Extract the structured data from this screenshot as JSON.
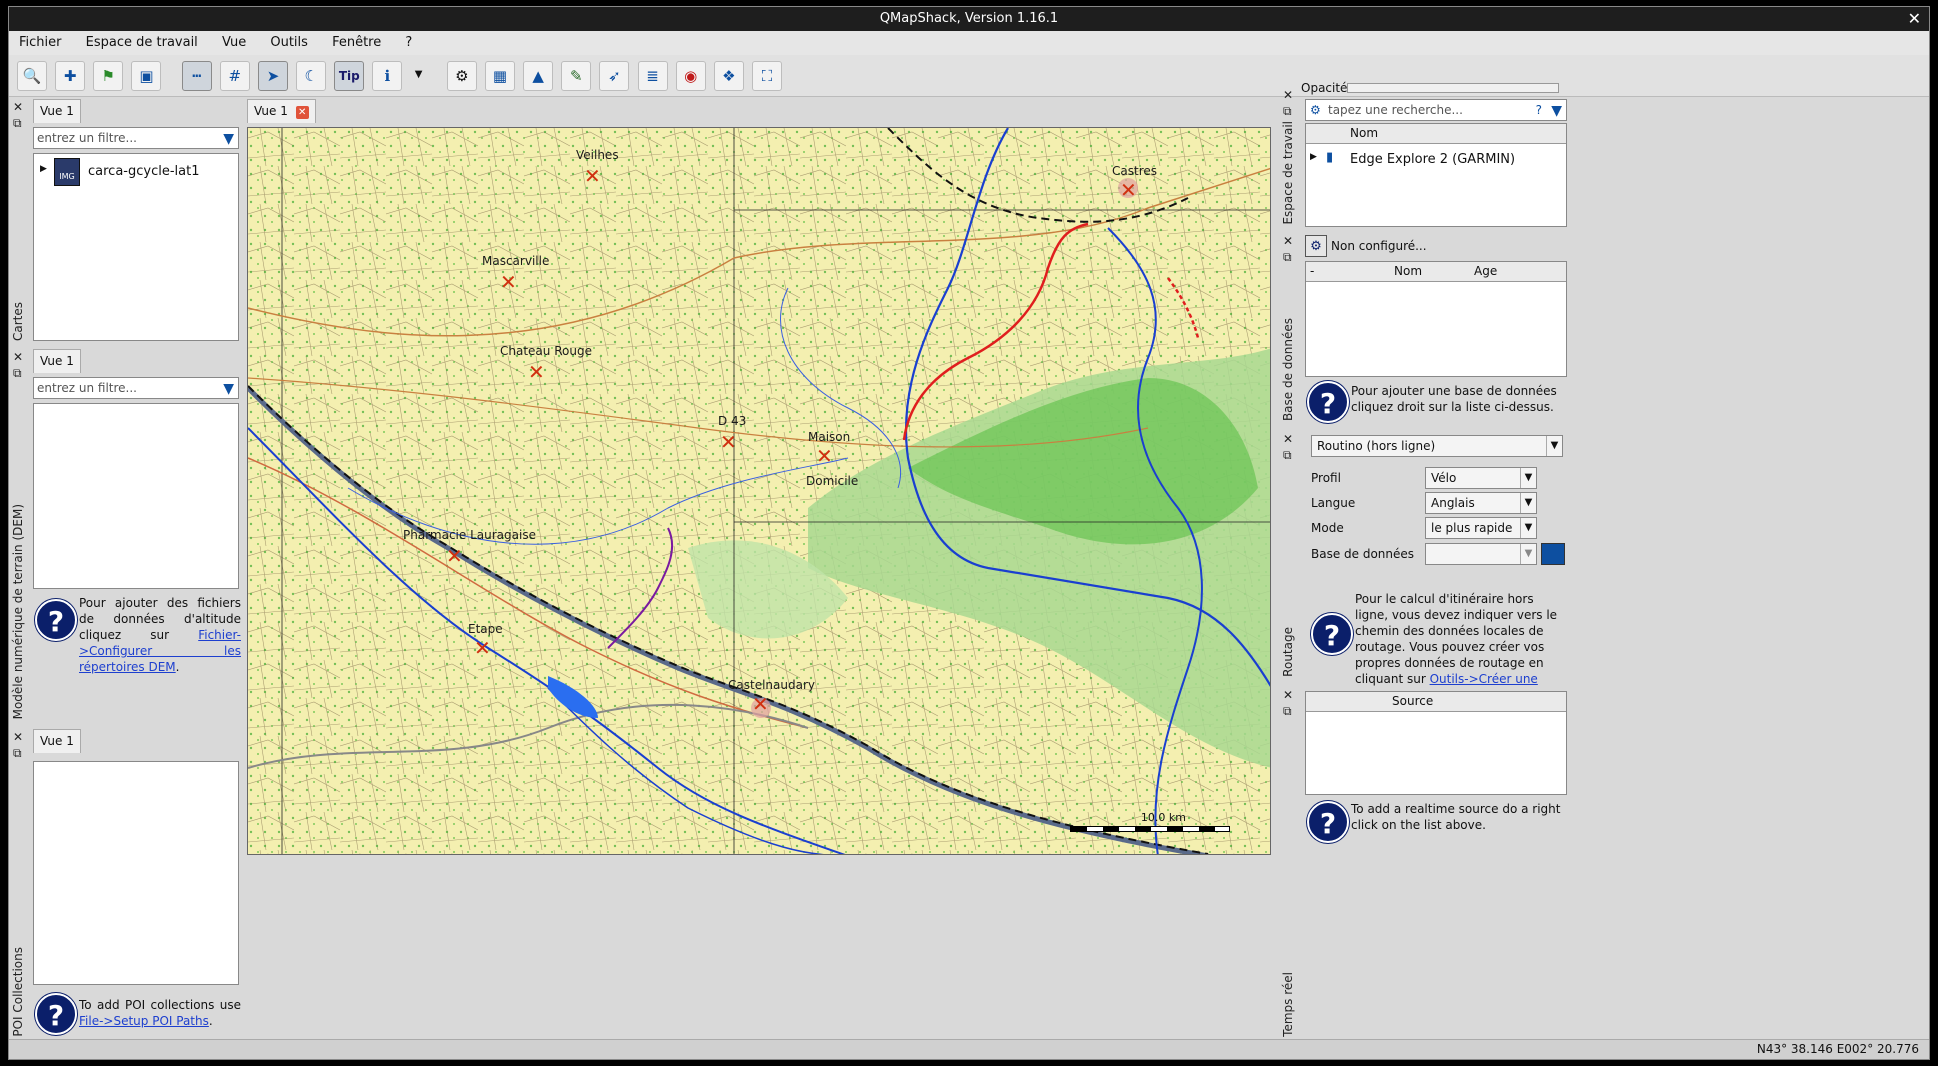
{
  "window": {
    "title": "QMapShack, Version 1.16.1"
  },
  "menu": [
    "Fichier",
    "Espace de travail",
    "Vue",
    "Outils",
    "Fenêtre",
    "?"
  ],
  "toolbar": {
    "icons": [
      "search-icon",
      "add-waypoint-icon",
      "flag-icon",
      "save-icon",
      "ruler-icon",
      "grid-icon",
      "cursor-icon",
      "night-icon",
      "tip-icon",
      "info-icon",
      "gear-icon",
      "map-icon",
      "image-icon",
      "edit-icon",
      "route-icon",
      "list-icon",
      "alert-icon",
      "overlay-icon",
      "fullscreen-icon"
    ],
    "tip_label": "Tip"
  },
  "left": {
    "maps": {
      "dock_title": "Cartes",
      "tab": "Vue 1",
      "filter_placeholder": "entrez un filtre...",
      "items": [
        {
          "badge": "IMG",
          "name": "carca-gcycle-lat1"
        }
      ]
    },
    "dem": {
      "dock_title": "Modèle numérique de terrain (DEM)",
      "tab": "Vue 1",
      "filter_placeholder": "entrez un filtre...",
      "help_text": "Pour ajouter des fichiers de données d'altitude cliquez sur",
      "help_link": "Fichier->Configurer les répertoires DEM",
      "help_tail": "."
    },
    "poi": {
      "dock_title": "POI Collections",
      "tab": "Vue 1",
      "help_text": "To add POI collections use",
      "help_link": "File->Setup POI Paths",
      "help_tail": "."
    }
  },
  "map": {
    "tab": "Vue 1",
    "towns": [
      "Veilhes",
      "Mascarville",
      "Chateau Rouge",
      "D 43",
      "Maison",
      "Domicile",
      "Pharmacie Lauragaise",
      "Etape",
      "Castelnaudary",
      "Castres"
    ],
    "scale": "10.0 km"
  },
  "right": {
    "opacity_label": "Opacité",
    "workspace": {
      "dock_title": "Espace de travail",
      "search_placeholder": "tapez une recherche...",
      "col_name": "Nom",
      "items": [
        {
          "name": "Edge Explore 2 (GARMIN)"
        }
      ]
    },
    "database": {
      "dock_title": "Base de données",
      "status": "Non configuré...",
      "col_dash": "-",
      "col_name": "Nom",
      "col_age": "Age",
      "help_text": "Pour ajouter une base de données cliquez droit sur la liste ci-dessus."
    },
    "routing": {
      "dock_title": "Routage",
      "router": "Routino (hors ligne)",
      "profile_label": "Profil",
      "profile_value": "Vélo",
      "language_label": "Langue",
      "language_value": "Anglais",
      "mode_label": "Mode",
      "mode_value": "le plus rapide",
      "db_label": "Base de données",
      "db_value": "",
      "help_text": "Pour le calcul d'itinéraire hors ligne, vous devez indiquer vers le chemin des données locales de routage. Vous pouvez créer vos propres données de routage en cliquant sur",
      "help_link": "Outils->Créer une base de données Routino"
    },
    "realtime": {
      "dock_title": "Temps réel",
      "col_source": "Source",
      "help_text": "To add a realtime source do a right click on the list above."
    }
  },
  "status": {
    "coords": "N43° 38.146 E002° 20.776"
  },
  "colors": {
    "map_bg": "#f4efb0",
    "accent": "#0b1f6a",
    "link": "#1d3fcf"
  }
}
